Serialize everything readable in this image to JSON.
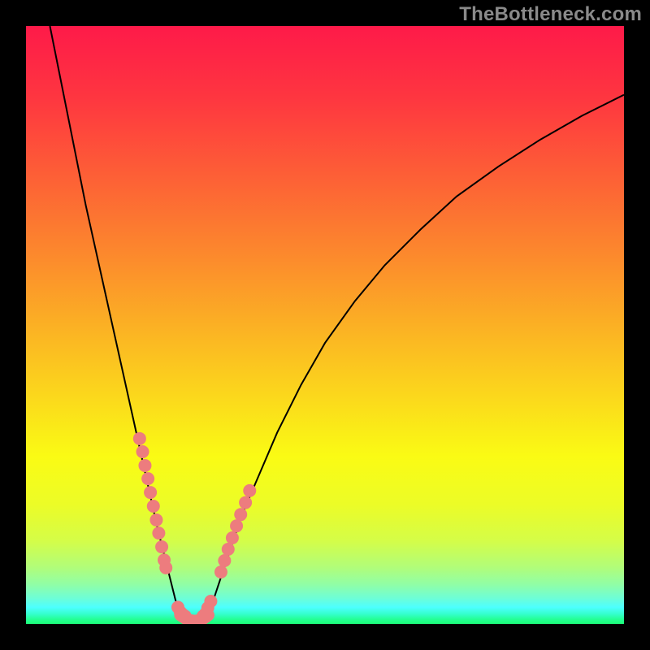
{
  "watermark": "TheBottleneck.com",
  "colors": {
    "marker": "#ED7C7E",
    "curve": "#000000",
    "frame": "#000000"
  },
  "gradient_stops": [
    {
      "offset": 0.0,
      "color": "#FE1A49"
    },
    {
      "offset": 0.12,
      "color": "#FE3640"
    },
    {
      "offset": 0.25,
      "color": "#FD5F36"
    },
    {
      "offset": 0.38,
      "color": "#FC882D"
    },
    {
      "offset": 0.5,
      "color": "#FBB024"
    },
    {
      "offset": 0.62,
      "color": "#FBD81C"
    },
    {
      "offset": 0.72,
      "color": "#FAFB14"
    },
    {
      "offset": 0.8,
      "color": "#ECFC27"
    },
    {
      "offset": 0.86,
      "color": "#D5FD47"
    },
    {
      "offset": 0.905,
      "color": "#B1FD79"
    },
    {
      "offset": 0.935,
      "color": "#8FFEA8"
    },
    {
      "offset": 0.957,
      "color": "#6DFED7"
    },
    {
      "offset": 0.972,
      "color": "#4DFFFE"
    },
    {
      "offset": 0.983,
      "color": "#35FFCE"
    },
    {
      "offset": 0.992,
      "color": "#24FF95"
    },
    {
      "offset": 1.0,
      "color": "#1CFF76"
    }
  ],
  "chart_data": {
    "type": "line",
    "title": "",
    "xlabel": "",
    "ylabel": "",
    "xlim": [
      0,
      100
    ],
    "ylim": [
      0,
      100
    ],
    "series": [
      {
        "name": "left-branch",
        "x": [
          4,
          6,
          8,
          10,
          12,
          14,
          16,
          18,
          19,
          20,
          21,
          22,
          23,
          24,
          25,
          25.8
        ],
        "y": [
          100,
          90,
          80,
          70,
          61,
          52,
          43,
          34,
          29.5,
          25,
          20.5,
          16,
          12,
          8,
          4,
          1.5
        ]
      },
      {
        "name": "right-branch",
        "x": [
          30.5,
          32,
          34,
          36,
          39,
          42,
          46,
          50,
          55,
          60,
          66,
          72,
          79,
          86,
          93,
          100
        ],
        "y": [
          1.5,
          6,
          12,
          18,
          25,
          32,
          40,
          47,
          54,
          60,
          66,
          71.5,
          76.5,
          81,
          85,
          88.5
        ]
      },
      {
        "name": "valley-floor",
        "x": [
          25.8,
          27,
          28.2,
          29.4,
          30.5
        ],
        "y": [
          1.5,
          0.7,
          0.5,
          0.7,
          1.5
        ]
      }
    ],
    "markers": {
      "left_cluster": {
        "x": [
          19.0,
          19.5,
          19.9,
          20.4,
          20.8,
          21.3,
          21.8,
          22.2,
          22.7,
          23.1,
          23.4,
          25.4,
          25.8,
          26.2,
          26.6
        ],
        "y": [
          31.0,
          28.8,
          26.5,
          24.3,
          22.0,
          19.7,
          17.4,
          15.2,
          12.9,
          10.7,
          9.4,
          2.8,
          2.0,
          1.6,
          1.3
        ]
      },
      "right_cluster": {
        "x": [
          29.6,
          30.0,
          30.4,
          30.9,
          32.6,
          33.2,
          33.8,
          34.5,
          35.2,
          35.9,
          36.7,
          37.4
        ],
        "y": [
          1.3,
          1.7,
          2.7,
          3.8,
          8.7,
          10.6,
          12.5,
          14.4,
          16.4,
          18.3,
          20.3,
          22.3
        ]
      }
    }
  }
}
